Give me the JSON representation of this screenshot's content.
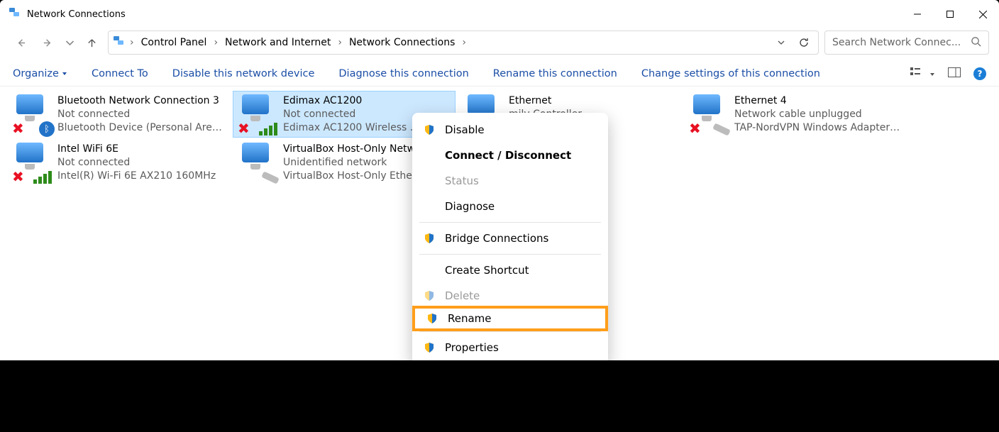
{
  "window": {
    "title": "Network Connections"
  },
  "breadcrumb": {
    "root": "Control Panel",
    "mid": "Network and Internet",
    "leaf": "Network Connections"
  },
  "search": {
    "placeholder": "Search Network Connec..."
  },
  "commands": {
    "organize": "Organize",
    "connect_to": "Connect To",
    "disable": "Disable this network device",
    "diagnose": "Diagnose this connection",
    "rename": "Rename this connection",
    "change_settings": "Change settings of this connection"
  },
  "connections": [
    {
      "id": "bt",
      "name": "Bluetooth Network Connection 3",
      "status": "Not connected",
      "device": "Bluetooth Device (Personal Area ...",
      "icon_variant": "bluetooth",
      "selected": false
    },
    {
      "id": "edimax",
      "name": "Edimax AC1200",
      "status": "Not connected",
      "device": "Edimax AC1200 Wireless ...",
      "icon_variant": "wifi",
      "selected": true
    },
    {
      "id": "eth",
      "name": "Ethernet",
      "status": "",
      "device": "mily Controller",
      "icon_variant": "ethernet",
      "selected": false
    },
    {
      "id": "eth4",
      "name": "Ethernet 4",
      "status": "Network cable unplugged",
      "device": "TAP-NordVPN Windows Adapter ...",
      "icon_variant": "ethernet",
      "selected": false
    },
    {
      "id": "wifi6e",
      "name": "Intel WiFi 6E",
      "status": "Not connected",
      "device": "Intel(R) Wi-Fi 6E AX210 160MHz",
      "icon_variant": "wifi",
      "selected": false
    },
    {
      "id": "vbox",
      "name": "VirtualBox Host-Only Network",
      "status": "Unidentified network",
      "device": "VirtualBox Host-Only Ethe...",
      "icon_variant": "ethernet-ok",
      "selected": false
    }
  ],
  "context_menu": {
    "disable": "Disable",
    "connect_disconnect": "Connect / Disconnect",
    "status": "Status",
    "diagnose": "Diagnose",
    "bridge": "Bridge Connections",
    "create_shortcut": "Create Shortcut",
    "delete": "Delete",
    "rename": "Rename",
    "properties": "Properties"
  }
}
